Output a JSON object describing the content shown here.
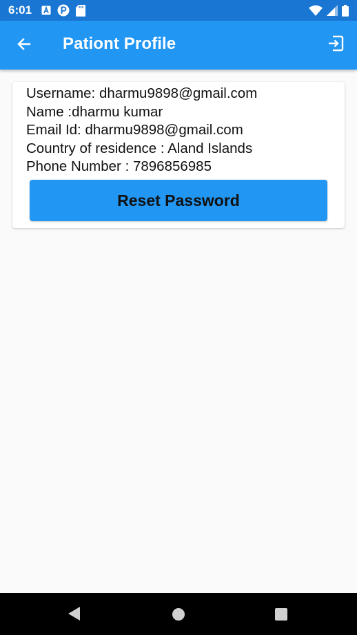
{
  "status_bar": {
    "time": "6:01",
    "left_icons": [
      "a-notification-icon",
      "p-notification-icon",
      "sd-card-icon"
    ],
    "right_icons": [
      "wifi-icon",
      "cell-signal-icon",
      "battery-icon"
    ]
  },
  "app_bar": {
    "title": "Pationt Profile",
    "back_icon": "arrow-left-icon",
    "logout_icon": "logout-icon",
    "color": "#2196f3"
  },
  "profile": {
    "username_line": "Username: dharmu9898@gmail.com",
    "name_line": "Name :dharmu kumar",
    "email_line": "Email Id: dharmu9898@gmail.com",
    "country_line": "Country of residence : Aland Islands",
    "phone_line": "Phone Number : 7896856985"
  },
  "actions": {
    "reset_label": "Reset Password"
  },
  "nav_bar": {
    "icons": [
      "nav-back-icon",
      "nav-home-icon",
      "nav-recents-icon"
    ]
  }
}
